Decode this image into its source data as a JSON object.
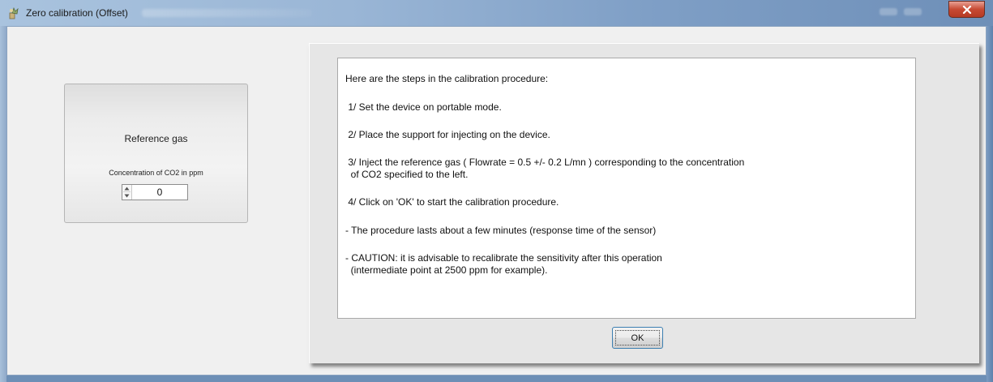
{
  "window": {
    "title": "Zero calibration (Offset)",
    "close_symbol": "✕"
  },
  "reference_panel": {
    "title": "Reference gas",
    "concentration_label": "Concentration of CO2 in ppm",
    "concentration_value": "0"
  },
  "procedure": {
    "lines": [
      "Here are the steps in the calibration procedure:",
      " 1/ Set the device on portable mode.",
      " 2/ Place the support for injecting on the device.",
      " 3/ Inject the reference gas ( Flowrate = 0.5 +/- 0.2 L/mn ) corresponding to the concentration",
      "  of CO2 specified to the left.",
      " 4/ Click on 'OK' to start the calibration procedure.",
      "- The procedure lasts about a few minutes (response time of the sensor)",
      "- CAUTION: it is advisable to recalibrate the sensitivity after this operation",
      "  (intermediate point at 2500 ppm for example)."
    ],
    "ok_label": "OK"
  },
  "colors": {
    "titlebar": "#9ab6d6",
    "close_button": "#c74a33",
    "client_background": "#f0f0f0",
    "panel_background": "#e6e6e6",
    "ok_focus_border": "#3c7fb1"
  },
  "icons": {
    "app_icon": "app-icon",
    "close_icon": "close-icon",
    "spin_up_icon": "triangle-up-icon",
    "spin_down_icon": "triangle-down-icon"
  }
}
